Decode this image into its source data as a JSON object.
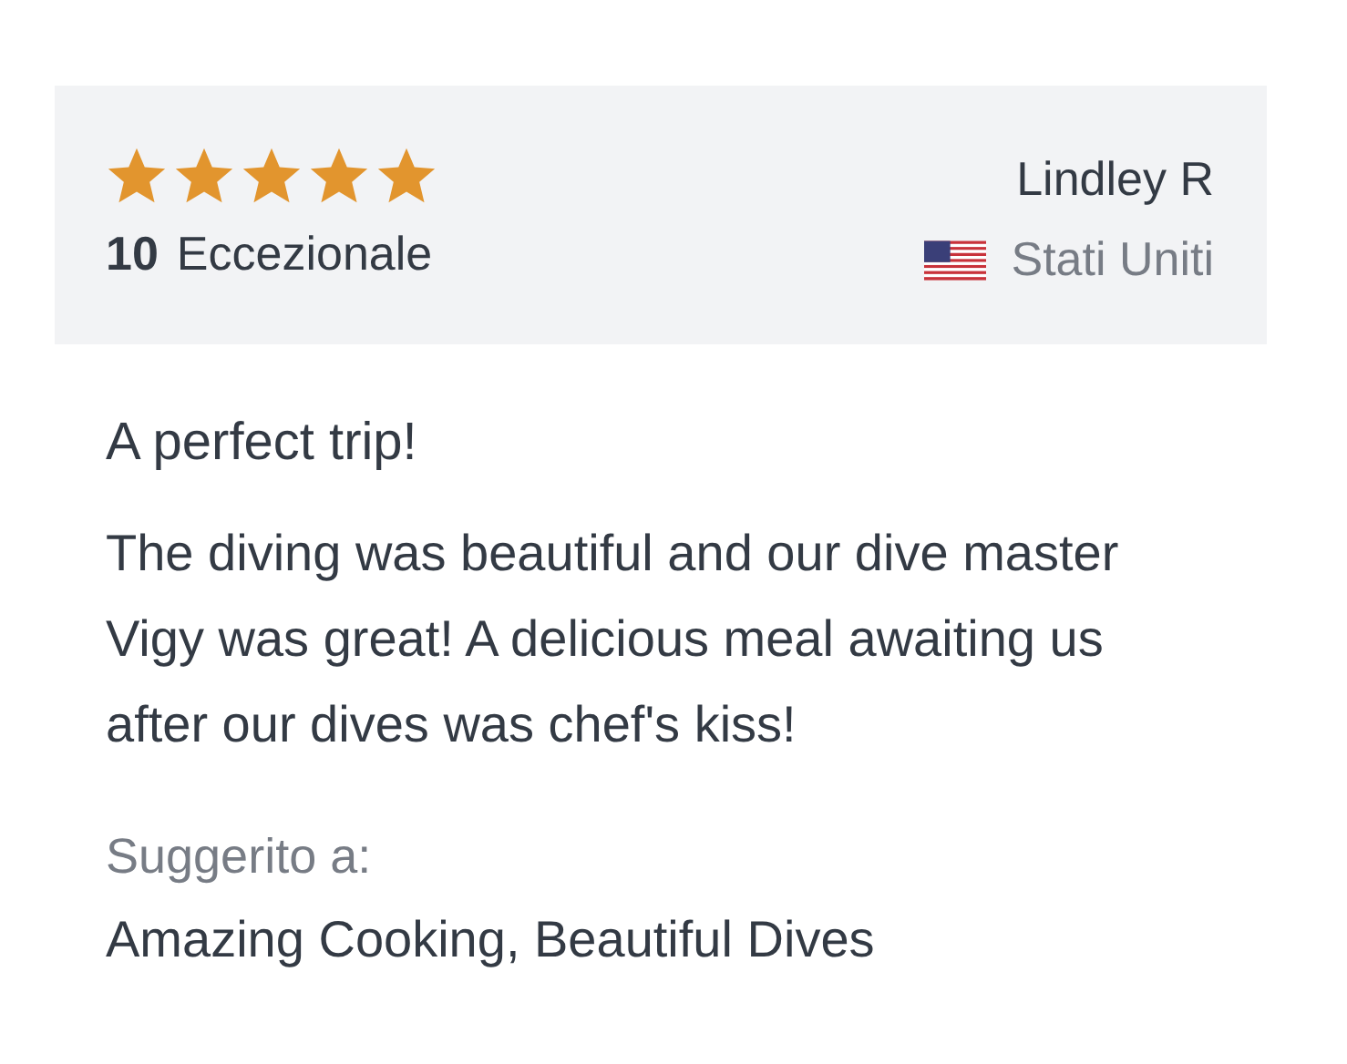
{
  "review": {
    "stars": 5,
    "score": "10",
    "rating_label": "Eccezionale",
    "author": "Lindley R",
    "country": "Stati Uniti",
    "title": "A perfect trip!",
    "text": "The diving was beautiful and our dive master Vigy was great! A delicious meal awaiting us after our dives was chef's kiss!",
    "recommended_label": "Suggerito a:",
    "recommended": "Amazing Cooking, Beautiful Dives"
  }
}
